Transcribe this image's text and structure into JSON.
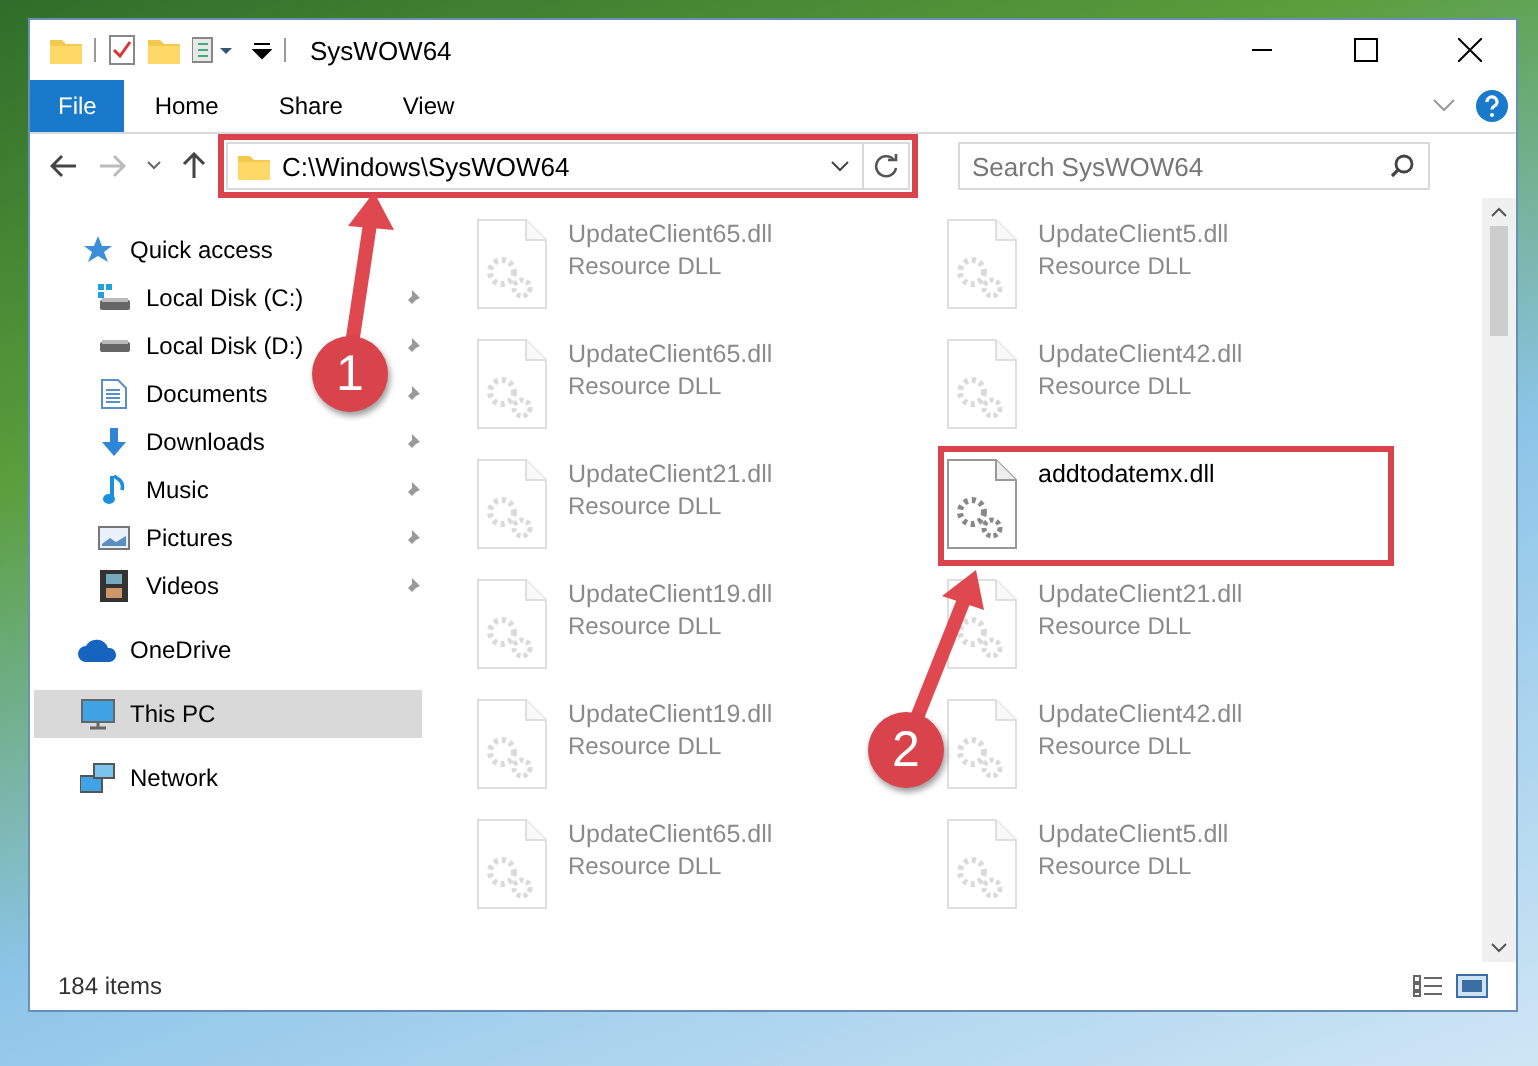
{
  "window": {
    "title": "SysWOW64"
  },
  "ribbon": {
    "tabs": [
      {
        "label": "File",
        "kind": "file"
      },
      {
        "label": "Home",
        "kind": "tab"
      },
      {
        "label": "Share",
        "kind": "tab"
      },
      {
        "label": "View",
        "kind": "tab"
      }
    ]
  },
  "address_bar": {
    "path": "C:\\Windows\\SysWOW64",
    "highlighted": true
  },
  "search": {
    "placeholder": "Search SysWOW64"
  },
  "sidebar": {
    "items": [
      {
        "label": "Quick access",
        "selected": false,
        "children": [
          {
            "label": "Local Disk (C:)",
            "pinned": true
          },
          {
            "label": "Local Disk (D:)",
            "pinned": true
          },
          {
            "label": "Documents",
            "pinned": true
          },
          {
            "label": "Downloads",
            "pinned": true
          },
          {
            "label": "Music",
            "pinned": true
          },
          {
            "label": "Pictures",
            "pinned": true
          },
          {
            "label": "Videos",
            "pinned": true
          }
        ]
      },
      {
        "label": "OneDrive",
        "selected": false
      },
      {
        "label": "This PC",
        "selected": true
      },
      {
        "label": "Network",
        "selected": false
      }
    ]
  },
  "files": [
    {
      "name": "UpdateClient65.dll",
      "type": "Resource DLL",
      "highlighted": false
    },
    {
      "name": "UpdateClient5.dll",
      "type": "Resource DLL",
      "highlighted": false
    },
    {
      "name": "UpdateClient65.dll",
      "type": "Resource DLL",
      "highlighted": false
    },
    {
      "name": "UpdateClient42.dll",
      "type": "Resource DLL",
      "highlighted": false
    },
    {
      "name": "UpdateClient21.dll",
      "type": "Resource DLL",
      "highlighted": false
    },
    {
      "name": "addtodatemx.dll",
      "highlighted": true
    },
    {
      "name": "UpdateClient19.dll",
      "type": "Resource DLL",
      "highlighted": false
    },
    {
      "name": "UpdateClient21.dll",
      "type": "Resource DLL",
      "highlighted": false
    },
    {
      "name": "UpdateClient19.dll",
      "type": "Resource DLL",
      "highlighted": false
    },
    {
      "name": "UpdateClient42.dll",
      "type": "Resource DLL",
      "highlighted": false
    },
    {
      "name": "UpdateClient65.dll",
      "type": "Resource DLL",
      "highlighted": false
    },
    {
      "name": "UpdateClient5.dll",
      "type": "Resource DLL",
      "highlighted": false
    }
  ],
  "status_bar": {
    "item_count": "184 items"
  },
  "annotations": [
    {
      "number": "1"
    },
    {
      "number": "2"
    }
  ]
}
